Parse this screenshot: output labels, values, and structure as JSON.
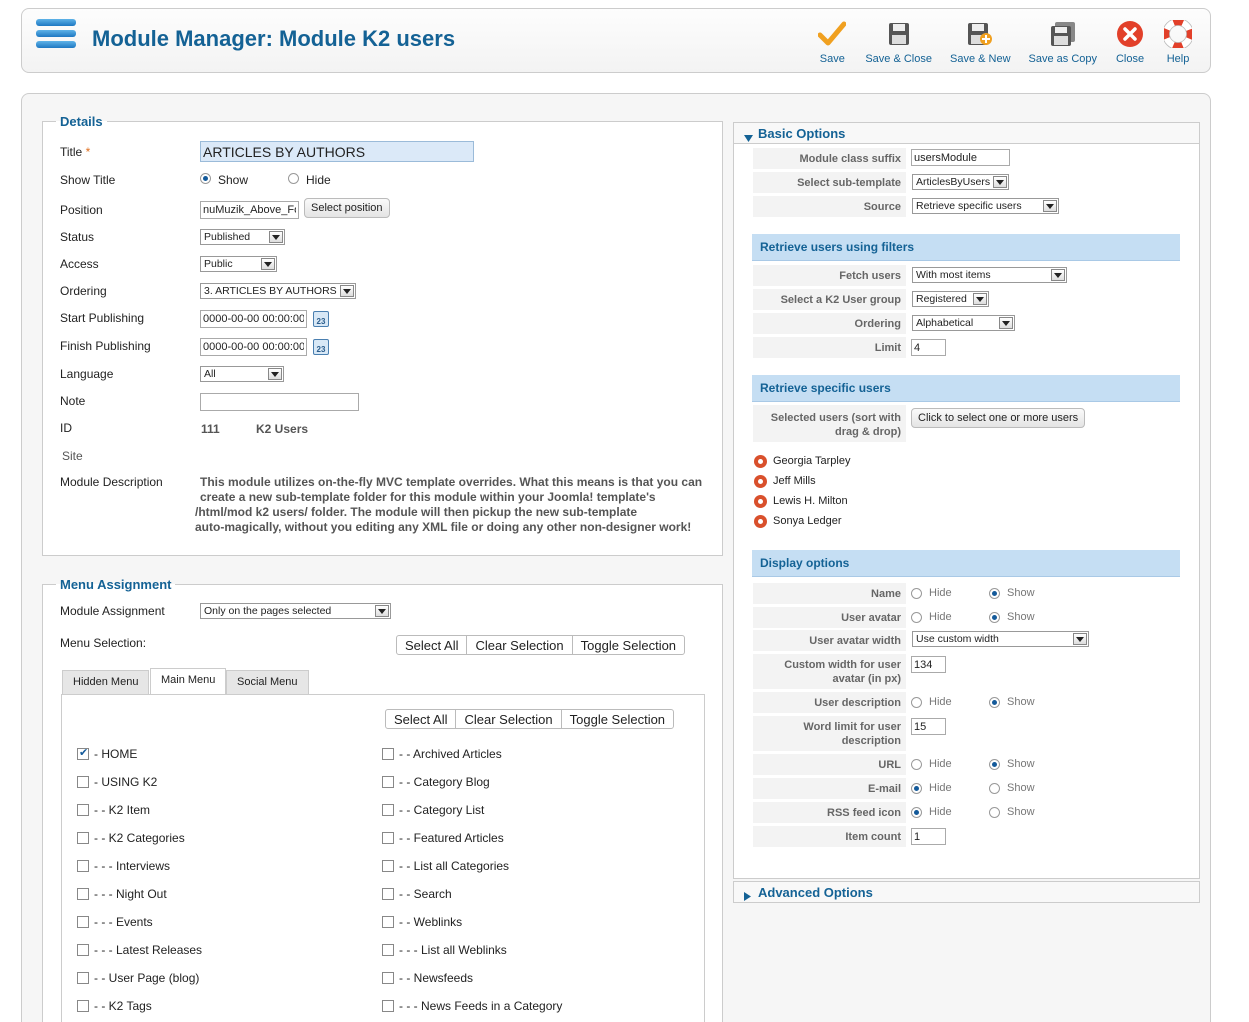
{
  "header": {
    "title": "Module Manager: Module K2 users",
    "toolbar": [
      {
        "label": "Save",
        "icon": "checkmark-icon"
      },
      {
        "label": "Save & Close",
        "icon": "floppy-icon"
      },
      {
        "label": "Save & New",
        "icon": "floppy-plus-icon"
      },
      {
        "label": "Save as Copy",
        "icon": "floppy-copy-icon"
      },
      {
        "label": "Close",
        "icon": "close-icon"
      },
      {
        "label": "Help",
        "icon": "lifebuoy-icon"
      }
    ]
  },
  "details": {
    "legend": "Details",
    "title_label": "Title",
    "title_required": "*",
    "title_value": "ARTICLES BY AUTHORS",
    "show_title_label": "Show Title",
    "show_label": "Show",
    "hide_label": "Hide",
    "position_label": "Position",
    "position_value": "nuMuzik_Above_Footer",
    "select_position": "Select position",
    "status_label": "Status",
    "status_value": "Published",
    "access_label": "Access",
    "access_value": "Public",
    "ordering_label": "Ordering",
    "ordering_value": "3. ARTICLES BY AUTHORS",
    "start_label": "Start Publishing",
    "start_value": "0000-00-00 00:00:00",
    "finish_label": "Finish Publishing",
    "finish_value": "0000-00-00 00:00:00",
    "calendar_day": "23",
    "language_label": "Language",
    "language_value": "All",
    "note_label": "Note",
    "note_value": "",
    "id_label": "ID",
    "id_value": "111",
    "id_name": "K2 Users",
    "site_label": "Site",
    "desc_label": "Module Description",
    "desc_lines": [
      "This module utilizes on-the-fly MVC template overrides. What this means is that you can",
      "create a new sub-template folder for this module within your Joomla! template's",
      "/html/mod k2 users/ folder. The module will then pickup the new sub-template",
      "auto-magically, without you editing any XML file or doing any other non-designer work!"
    ]
  },
  "menu": {
    "legend": "Menu Assignment",
    "assignment_label": "Module Assignment",
    "assignment_value": "Only on the pages selected",
    "selection_label": "Menu Selection:",
    "select_all": "Select All",
    "clear_selection": "Clear Selection",
    "toggle_selection": "Toggle Selection",
    "tabs": [
      "Hidden Menu",
      "Main Menu",
      "Social Menu"
    ],
    "left_items": [
      {
        "label": "- HOME",
        "checked": true
      },
      {
        "label": "- USING K2",
        "checked": false
      },
      {
        "label": "- - K2 Item",
        "checked": false
      },
      {
        "label": "- - K2 Categories",
        "checked": false
      },
      {
        "label": "- - - Interviews",
        "checked": false
      },
      {
        "label": "- - - Night Out",
        "checked": false
      },
      {
        "label": "- - - Events",
        "checked": false
      },
      {
        "label": "- - - Latest Releases",
        "checked": false
      },
      {
        "label": "- - User Page (blog)",
        "checked": false
      },
      {
        "label": "- - K2 Tags",
        "checked": false
      }
    ],
    "right_items": [
      {
        "label": "- - Archived Articles",
        "checked": false
      },
      {
        "label": "- - Category Blog",
        "checked": false
      },
      {
        "label": "- - Category List",
        "checked": false
      },
      {
        "label": "- - Featured Articles",
        "checked": false
      },
      {
        "label": "- - List all Categories",
        "checked": false
      },
      {
        "label": "- - Search",
        "checked": false
      },
      {
        "label": "- - Weblinks",
        "checked": false
      },
      {
        "label": "- - - List all Weblinks",
        "checked": false
      },
      {
        "label": "- - Newsfeeds",
        "checked": false
      },
      {
        "label": "- - - News Feeds in a Category",
        "checked": false
      }
    ]
  },
  "basic": {
    "heading": "Basic Options",
    "class_suffix_label": "Module class suffix",
    "class_suffix_value": "usersModule",
    "subtemplate_label": "Select sub-template",
    "subtemplate_value": "ArticlesByUsers",
    "source_label": "Source",
    "source_value": "Retrieve specific users",
    "filters_heading": "Retrieve users using filters",
    "fetch_label": "Fetch users",
    "fetch_value": "With most items",
    "group_label": "Select a K2 User group",
    "group_value": "Registered",
    "ordering_label": "Ordering",
    "ordering_value": "Alphabetical",
    "limit_label": "Limit",
    "limit_value": "4",
    "specific_heading": "Retrieve specific users",
    "selected_label_1": "Selected users (sort with",
    "selected_label_2": "drag & drop)",
    "select_users_button": "Click to select one or more users",
    "users": [
      "Georgia Tarpley",
      "Jeff Mills",
      "Lewis H. Milton",
      "Sonya Ledger"
    ],
    "display_heading": "Display options",
    "hide": "Hide",
    "show": "Show",
    "name_label": "Name",
    "avatar_label": "User avatar",
    "avatar_width_label": "User avatar width",
    "avatar_width_value": "Use custom width",
    "custom_width_label_1": "Custom width for user",
    "custom_width_label_2": "avatar (in px)",
    "custom_width_value": "134",
    "description_label": "User description",
    "word_limit_label_1": "Word limit for user",
    "word_limit_label_2": "description",
    "word_limit_value": "15",
    "url_label": "URL",
    "email_label": "E-mail",
    "rss_label": "RSS feed icon",
    "item_count_label": "Item count",
    "item_count_value": "1"
  },
  "advanced": {
    "heading": "Advanced Options"
  },
  "colors": {
    "accent": "#146295",
    "subheader": "#c5def3",
    "close": "#e2402a"
  }
}
